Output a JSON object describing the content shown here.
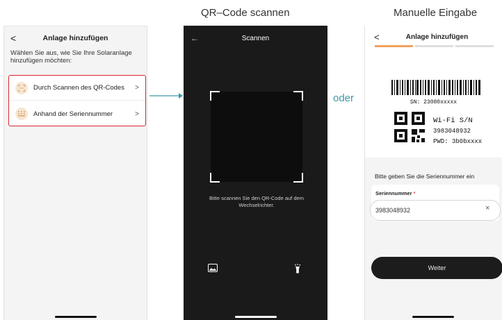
{
  "captions": {
    "scan": "QR–Code scannen",
    "manual": "Manuelle Eingabe"
  },
  "screen1": {
    "back": "<",
    "title": "Anlage hinzufügen",
    "instruction": "Wählen Sie aus, wie Sie Ihre Solaranlage hinzufügen möchten:",
    "options": [
      {
        "label": "Durch Scannen des QR-Codes",
        "icon": "scan-frame-icon",
        "chevron": ">"
      },
      {
        "label": "Anhand der Seriennummer",
        "icon": "keypad-icon",
        "chevron": ">"
      }
    ],
    "highlight_color": "#d9262f"
  },
  "screen2": {
    "back": "←",
    "title": "Scannen",
    "hint": "Bitte scannen Sie den QR-Code auf dem Wechselrichter.",
    "gallery_icon": "image-icon",
    "torch_icon": "flashlight-icon"
  },
  "connector": "oder",
  "screen3": {
    "back": "<",
    "title": "Anlage hinzufügen",
    "progress_steps": 3,
    "progress_active": 1,
    "label": {
      "sn": "SN: 23080xxxxx",
      "wifi_title": "Wi-Fi  S/N",
      "wifi_sn": "3983048932",
      "pwd": "PWD: 3b0bxxxx"
    },
    "prompt": "Bitte geben Sie die Seriennummer ein",
    "field_label": "Seriennummer",
    "required_mark": "*",
    "field_value": "3983048932",
    "clear": "×",
    "button": "Weiter",
    "accent_color": "#f0a05a"
  }
}
